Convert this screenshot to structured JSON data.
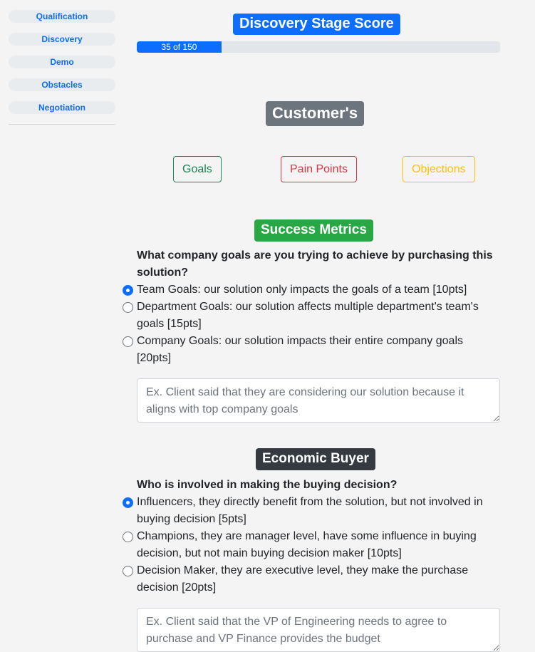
{
  "sidebar": {
    "items": [
      {
        "label": "Qualification"
      },
      {
        "label": "Discovery"
      },
      {
        "label": "Demo"
      },
      {
        "label": "Obstacles"
      },
      {
        "label": "Negotiation"
      }
    ]
  },
  "header": {
    "title": "Discovery Stage Score",
    "progress_text": "35 of 150",
    "progress_fraction": 0.233
  },
  "customer": {
    "title": "Customer's",
    "buttons": {
      "goals": "Goals",
      "pain_points": "Pain Points",
      "objections": "Objections"
    }
  },
  "success_metrics": {
    "title": "Success Metrics",
    "question": "What company goals are you trying to achieve by purchasing this solution?",
    "options": [
      {
        "label": "Team Goals: our solution only impacts the goals of a team [10pts]",
        "checked": true
      },
      {
        "label": "Department Goals: our solution affects multiple department's team's goals [15pts]",
        "checked": false
      },
      {
        "label": "Company Goals: our solution impacts their entire company goals [20pts]",
        "checked": false
      }
    ],
    "notes_placeholder": "Ex. Client said that they are considering our solution because it aligns with top company goals"
  },
  "economic_buyer": {
    "title": "Economic Buyer",
    "question": "Who is involved in making the buying decision?",
    "options": [
      {
        "label": "Influencers, they directly benefit from the solution, but not involved in buying decision [5pts]",
        "checked": true
      },
      {
        "label": "Champions, they are manager level, have some influence in buying decision, but not main buying decision maker [10pts]",
        "checked": false
      },
      {
        "label": "Decision Maker, they are executive level, they make the purchase decision [20pts]",
        "checked": false
      }
    ],
    "notes_placeholder": "Ex. Client said that the VP of Engineering needs to agree to purchase and VP Finance provides the budget"
  },
  "colors": {
    "primary": "#0d6efd",
    "success": "#28a745",
    "danger": "#dc3545",
    "warning": "#ffc107",
    "secondary": "#6c757d",
    "dark": "#343a40"
  }
}
